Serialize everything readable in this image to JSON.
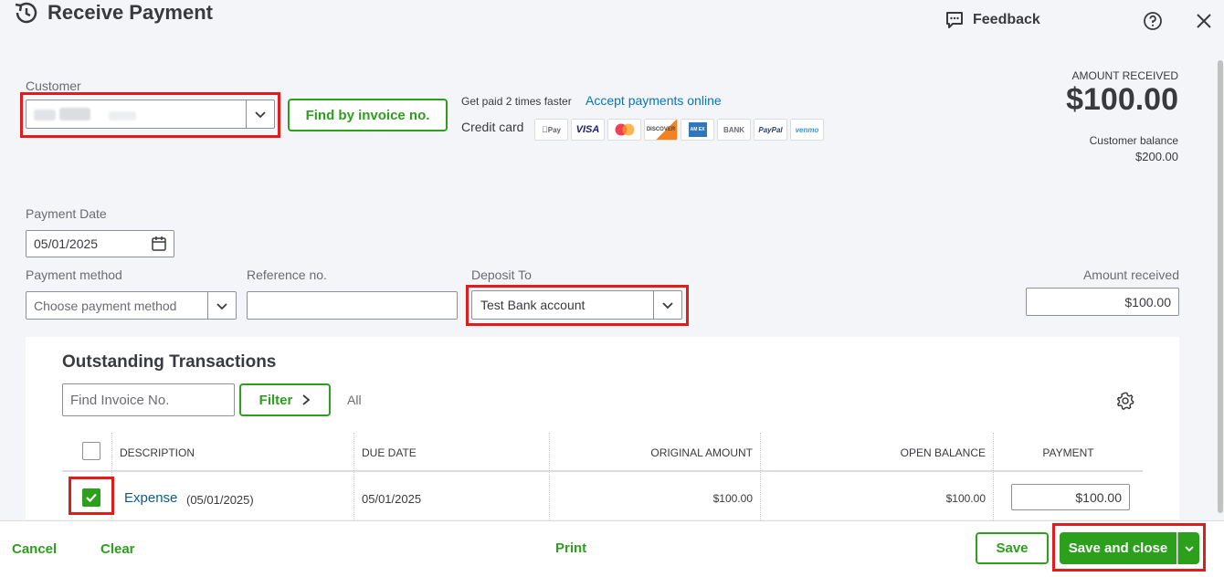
{
  "header": {
    "title": "Receive Payment",
    "feedback_label": "Feedback",
    "history_icon": "history-icon",
    "help_icon": "help-icon",
    "close_icon": "close-icon"
  },
  "customer": {
    "label": "Customer",
    "value": ""
  },
  "find_by_invoice_label": "Find by invoice no.",
  "online_payments": {
    "promo_text": "Get paid 2 times faster",
    "link_text": "Accept payments online",
    "credit_card_label": "Credit card",
    "methods": [
      "Pay",
      "VISA",
      "",
      "DISCOVER",
      "",
      "BANK",
      "PayPal",
      "venmo"
    ]
  },
  "summary": {
    "amount_received_label": "AMOUNT RECEIVED",
    "amount_received_value": "$100.00",
    "customer_balance_label": "Customer balance",
    "customer_balance_value": "$200.00"
  },
  "form": {
    "payment_date_label": "Payment Date",
    "payment_date_value": "05/01/2025",
    "payment_method_label": "Payment method",
    "payment_method_placeholder": "Choose payment method",
    "reference_label": "Reference no.",
    "reference_value": "",
    "deposit_to_label": "Deposit To",
    "deposit_to_value": "Test Bank account",
    "amount_received_label": "Amount received",
    "amount_received_value": "$100.00"
  },
  "outstanding": {
    "title": "Outstanding Transactions",
    "find_placeholder": "Find Invoice No.",
    "filter_label": "Filter",
    "filter_state": "All",
    "columns": [
      "DESCRIPTION",
      "DUE DATE",
      "ORIGINAL AMOUNT",
      "OPEN BALANCE",
      "PAYMENT"
    ],
    "rows": [
      {
        "checked": true,
        "description": "Expense",
        "description_date": "(05/01/2025)",
        "due_date": "05/01/2025",
        "original_amount": "$100.00",
        "open_balance": "$100.00",
        "payment": "$100.00"
      }
    ]
  },
  "footer": {
    "cancel_label": "Cancel",
    "clear_label": "Clear",
    "print_label": "Print",
    "save_label": "Save",
    "save_close_label": "Save and close"
  },
  "colors": {
    "brand_green": "#2ca01c",
    "link_blue": "#0077c5",
    "highlight_red": "#e21b1b",
    "background": "#f4f5f8"
  }
}
